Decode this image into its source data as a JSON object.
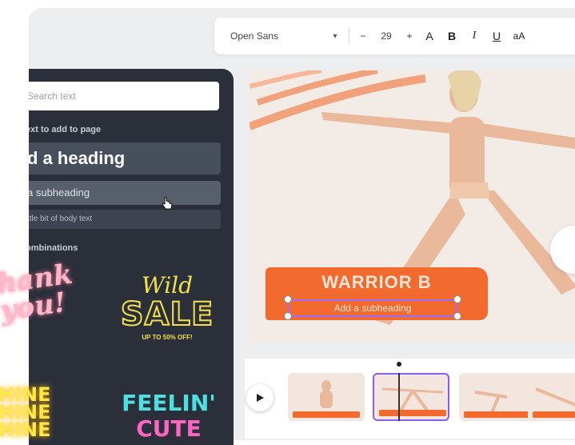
{
  "toolbar": {
    "font_name": "Open Sans",
    "font_dropdown_icon": "chevron-down-icon",
    "decrease_label": "−",
    "font_size": "29",
    "increase_label": "+",
    "color_label": "A",
    "bold_label": "B",
    "italic_label": "I",
    "underline_label": "U",
    "case_label": "aA"
  },
  "text_panel": {
    "search_placeholder": "Search text",
    "click_label": "ext to add to page",
    "heading_label": "d a heading",
    "subheading_label": "a subheading",
    "body_label": "ttle bit of body text",
    "combinations_label": "ombinations"
  },
  "combinations": {
    "thank_you": "hank you!",
    "wild": "Wild",
    "sale": "SALE",
    "sale_sub": "UP TO 50% OFF!",
    "shine": "HINE HINE HINE",
    "feelin": "FEELIN'",
    "cute": "CUTE"
  },
  "canvas": {
    "title": "WARRIOR B",
    "subheading": "Add a subheading"
  },
  "timeline": {
    "play_icon": "play-icon"
  },
  "colors": {
    "accent_orange": "#f26a2e",
    "selection_purple": "#8b5cf6",
    "panel_bg": "#2a2f3a"
  }
}
